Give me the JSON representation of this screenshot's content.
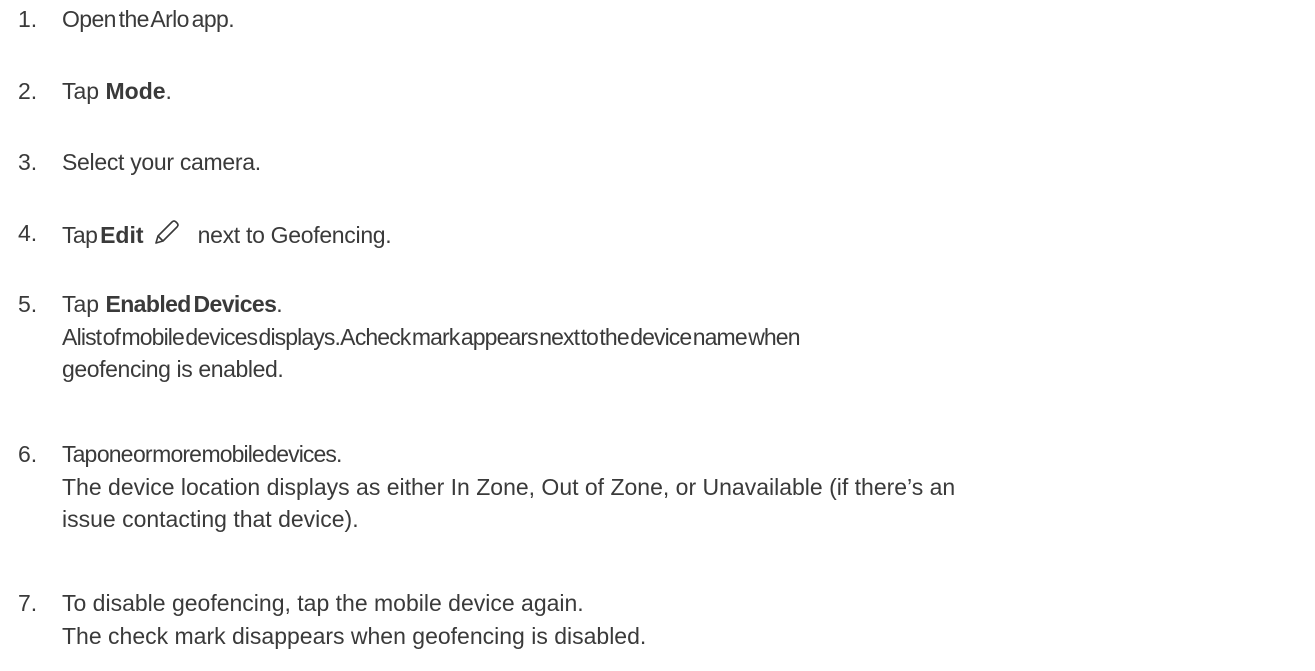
{
  "steps": [
    {
      "num": "1.",
      "text": "Open the Arlo app."
    },
    {
      "num": "2.",
      "prefix": "Tap ",
      "bold": "Mode",
      "suffix": "."
    },
    {
      "num": "3.",
      "text": "Select your camera."
    },
    {
      "num": "4.",
      "prefix": "Tap ",
      "bold": "Edit",
      "icon": "pencil-icon",
      "suffix": " next to Geofencing."
    },
    {
      "num": "5.",
      "prefix": "Tap ",
      "bold": "Enabled Devices",
      "suffix": ".",
      "desc": [
        "A list of mobile devices displays. A check mark appears next to the device name when",
        "geofencing is enabled."
      ]
    },
    {
      "num": "6.",
      "text": "Tap one or more mobile devices.",
      "desc": [
        "The device location displays as either In Zone, Out of Zone, or Unavailable (if there’s an",
        "issue contacting that device)."
      ]
    },
    {
      "num": "7.",
      "text": "To disable geofencing, tap the mobile device again.",
      "desc": [
        "The check mark disappears when geofencing is disabled."
      ]
    }
  ],
  "colors": {
    "text": "#3a3a3a",
    "icon": "#3a3a3a"
  }
}
